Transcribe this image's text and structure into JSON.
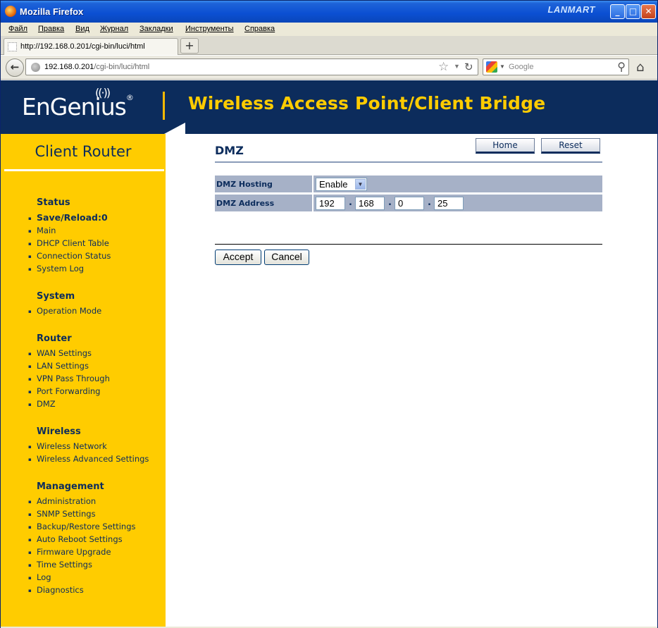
{
  "window": {
    "title": "Mozilla Firefox",
    "brand": "LANMART"
  },
  "menu": [
    "Файл",
    "Правка",
    "Вид",
    "Журнал",
    "Закладки",
    "Инструменты",
    "Справка"
  ],
  "tab": {
    "title": "http://192.168.0.201/cgi-bin/luci/html",
    "new_tab": "+"
  },
  "nav": {
    "url_host": "192.168.0.201",
    "url_path": "/cgi-bin/luci/html",
    "search_placeholder": "Google"
  },
  "banner": {
    "logo": "EnGenius",
    "logo_mark": "®",
    "title": "Wireless Access Point/Client Bridge"
  },
  "sidebar": {
    "title": "Client Router",
    "sections": [
      {
        "heading": "Status",
        "items": [
          "Save/Reload:0",
          "Main",
          "DHCP Client Table",
          "Connection Status",
          "System Log"
        ]
      },
      {
        "heading": "System",
        "items": [
          "Operation Mode"
        ]
      },
      {
        "heading": "Router",
        "items": [
          "WAN Settings",
          "LAN Settings",
          "VPN Pass Through",
          "Port Forwarding",
          "DMZ"
        ]
      },
      {
        "heading": "Wireless",
        "items": [
          "Wireless Network",
          "Wireless Advanced Settings"
        ]
      },
      {
        "heading": "Management",
        "items": [
          "Administration",
          "SNMP Settings",
          "Backup/Restore Settings",
          "Auto Reboot Settings",
          "Firmware Upgrade",
          "Time Settings",
          "Log",
          "Diagnostics"
        ]
      }
    ]
  },
  "content": {
    "title": "DMZ",
    "home_button": "Home",
    "reset_button": "Reset",
    "dmz_hosting_label": "DMZ Hosting",
    "dmz_hosting_value": "Enable",
    "dmz_address_label": "DMZ Address",
    "ip": [
      "192",
      "168",
      "0",
      "25"
    ],
    "ip_separator": ".",
    "accept_button": "Accept",
    "cancel_button": "Cancel"
  },
  "colors": {
    "banner": "#0c2c5c",
    "accent_yellow": "#ffcc00",
    "row_bg": "#a6b1c7"
  }
}
